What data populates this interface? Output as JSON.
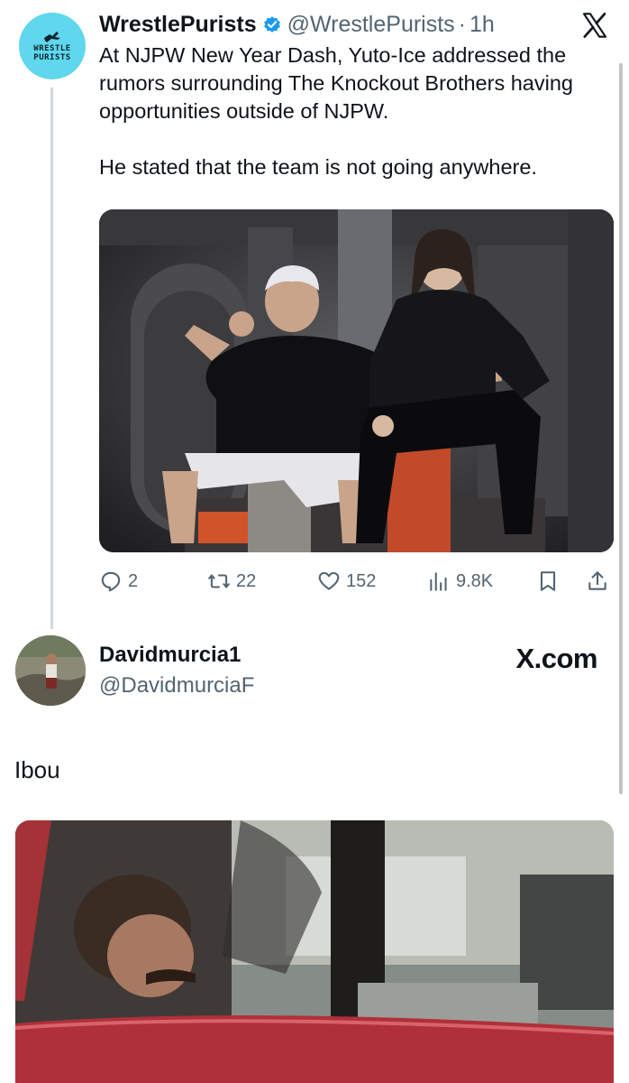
{
  "quoted_tweet": {
    "author_name": "WrestlePurists",
    "handle": "@WrestlePurists",
    "separator": "·",
    "time": "1h",
    "avatar_text": [
      "WRESTLE",
      "PURISTS"
    ],
    "paragraphs": [
      "At NJPW New Year Dash, Yuto-Ice addressed the rumors surrounding The Knockout Brothers having opportunities outside of NJPW.",
      "He stated that the team is not going anywhere."
    ],
    "stats": {
      "replies": "2",
      "retweets": "22",
      "likes": "152",
      "views": "9.8K"
    },
    "icons": [
      "verified-badge-icon",
      "x-logo-icon",
      "reply-icon",
      "retweet-icon",
      "like-icon",
      "views-icon",
      "bookmark-icon",
      "share-icon"
    ]
  },
  "reply": {
    "author_name": "Davidmurcia1",
    "handle": "@DavidmurciaF",
    "watermark": "X.com",
    "text": "Ibou"
  },
  "colors": {
    "text": "#0f1419",
    "secondary": "#536471",
    "verified": "#1d9bf0",
    "avatar_bg": "#5fd7ec",
    "thread_line": "#cfd9de"
  }
}
